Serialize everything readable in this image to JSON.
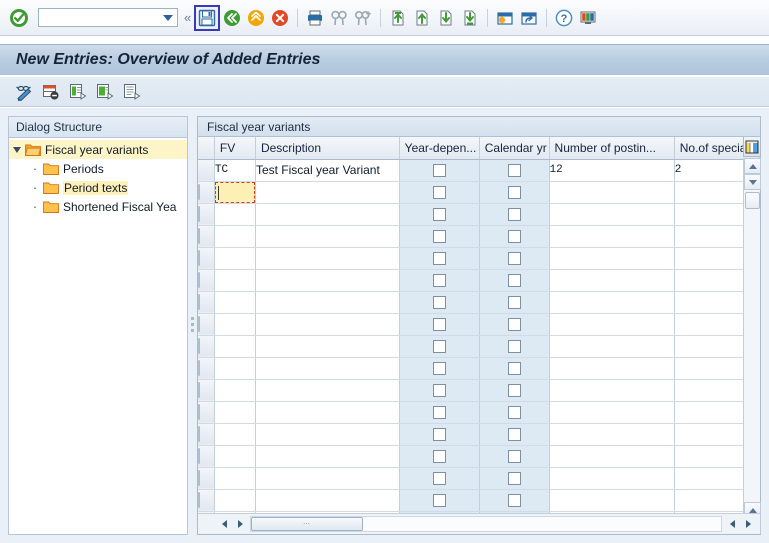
{
  "toolbar": {
    "enter_label": "enter-check",
    "command_value": "",
    "command_placeholder": "",
    "collapse_label": "«",
    "buttons": [
      {
        "name": "save-button",
        "label": "Save",
        "selected": true
      },
      {
        "name": "back-button",
        "label": "Back",
        "selected": false
      },
      {
        "name": "exit-button",
        "label": "Exit",
        "selected": false
      },
      {
        "name": "cancel-button",
        "label": "Cancel",
        "selected": false
      },
      {
        "name": "print-button",
        "label": "Print",
        "selected": false
      },
      {
        "name": "find-button",
        "label": "Find",
        "selected": false
      },
      {
        "name": "find-next-button",
        "label": "Find Next",
        "selected": false
      },
      {
        "name": "first-page-button",
        "label": "First Page",
        "selected": false
      },
      {
        "name": "previous-page-button",
        "label": "Previous Page",
        "selected": false
      },
      {
        "name": "next-page-button",
        "label": "Next Page",
        "selected": false
      },
      {
        "name": "last-page-button",
        "label": "Last Page",
        "selected": false
      },
      {
        "name": "create-session-button",
        "label": "Create New Session",
        "selected": false
      },
      {
        "name": "create-shortcut-button",
        "label": "Create Shortcut",
        "selected": false
      },
      {
        "name": "help-button",
        "label": "Help",
        "selected": false
      },
      {
        "name": "customize-layout-button",
        "label": "Customize Local Layout",
        "selected": false
      }
    ]
  },
  "title": {
    "text": "New Entries: Overview of Added Entries"
  },
  "app_toolbar": {
    "buttons": [
      {
        "name": "new-entries-button",
        "label": "New Entries"
      },
      {
        "name": "delete-entry-button",
        "label": "Delete"
      },
      {
        "name": "copy-as-button",
        "label": "Copy As"
      },
      {
        "name": "undo-change-button",
        "label": "Undo Change"
      },
      {
        "name": "select-all-button",
        "label": "Select Block"
      }
    ]
  },
  "sidebar": {
    "header": "Dialog Structure",
    "items": [
      {
        "label": "Fiscal year variants",
        "level": 0,
        "expanded": true,
        "selected": true,
        "icon": "open-folder-icon"
      },
      {
        "label": "Periods",
        "level": 1,
        "expanded": false,
        "selected": false,
        "icon": "folder-icon"
      },
      {
        "label": "Period texts",
        "level": 1,
        "expanded": false,
        "selected": true,
        "icon": "folder-icon"
      },
      {
        "label": "Shortened Fiscal Yea",
        "level": 1,
        "expanded": false,
        "selected": false,
        "icon": "folder-icon"
      }
    ]
  },
  "table": {
    "title": "Fiscal year variants",
    "columns": [
      {
        "key": "fv",
        "label": "FV",
        "type": "text",
        "width": 40
      },
      {
        "key": "description",
        "label": "Description",
        "type": "text",
        "width": 180
      },
      {
        "key": "year_dependent",
        "label": "Year-depen...",
        "type": "checkbox",
        "width": 78
      },
      {
        "key": "calendar_yr",
        "label": "Calendar yr",
        "type": "checkbox",
        "width": 68
      },
      {
        "key": "number_of_postings",
        "label": "Number of postin...",
        "type": "text",
        "width": 122
      },
      {
        "key": "no_of_special_periods",
        "label": "No.of special peri",
        "type": "text",
        "width": 112
      }
    ],
    "rows": [
      {
        "fv": "TC",
        "description": "Test Fiscal year Variant",
        "year_dependent": false,
        "calendar_yr": false,
        "number_of_postings": "12",
        "no_of_special_periods": "2",
        "editing": false
      },
      {
        "fv": "",
        "description": "",
        "year_dependent": false,
        "calendar_yr": false,
        "number_of_postings": "",
        "no_of_special_periods": "",
        "editing": true
      },
      {
        "fv": "",
        "description": "",
        "year_dependent": false,
        "calendar_yr": false,
        "number_of_postings": "",
        "no_of_special_periods": "",
        "editing": false
      },
      {
        "fv": "",
        "description": "",
        "year_dependent": false,
        "calendar_yr": false,
        "number_of_postings": "",
        "no_of_special_periods": "",
        "editing": false
      },
      {
        "fv": "",
        "description": "",
        "year_dependent": false,
        "calendar_yr": false,
        "number_of_postings": "",
        "no_of_special_periods": "",
        "editing": false
      },
      {
        "fv": "",
        "description": "",
        "year_dependent": false,
        "calendar_yr": false,
        "number_of_postings": "",
        "no_of_special_periods": "",
        "editing": false
      },
      {
        "fv": "",
        "description": "",
        "year_dependent": false,
        "calendar_yr": false,
        "number_of_postings": "",
        "no_of_special_periods": "",
        "editing": false
      },
      {
        "fv": "",
        "description": "",
        "year_dependent": false,
        "calendar_yr": false,
        "number_of_postings": "",
        "no_of_special_periods": "",
        "editing": false
      },
      {
        "fv": "",
        "description": "",
        "year_dependent": false,
        "calendar_yr": false,
        "number_of_postings": "",
        "no_of_special_periods": "",
        "editing": false
      },
      {
        "fv": "",
        "description": "",
        "year_dependent": false,
        "calendar_yr": false,
        "number_of_postings": "",
        "no_of_special_periods": "",
        "editing": false
      },
      {
        "fv": "",
        "description": "",
        "year_dependent": false,
        "calendar_yr": false,
        "number_of_postings": "",
        "no_of_special_periods": "",
        "editing": false
      },
      {
        "fv": "",
        "description": "",
        "year_dependent": false,
        "calendar_yr": false,
        "number_of_postings": "",
        "no_of_special_periods": "",
        "editing": false
      },
      {
        "fv": "",
        "description": "",
        "year_dependent": false,
        "calendar_yr": false,
        "number_of_postings": "",
        "no_of_special_periods": "",
        "editing": false
      },
      {
        "fv": "",
        "description": "",
        "year_dependent": false,
        "calendar_yr": false,
        "number_of_postings": "",
        "no_of_special_periods": "",
        "editing": false
      },
      {
        "fv": "",
        "description": "",
        "year_dependent": false,
        "calendar_yr": false,
        "number_of_postings": "",
        "no_of_special_periods": "",
        "editing": false
      },
      {
        "fv": "",
        "description": "",
        "year_dependent": false,
        "calendar_yr": false,
        "number_of_postings": "",
        "no_of_special_periods": "",
        "editing": false
      },
      {
        "fv": "",
        "description": "",
        "year_dependent": false,
        "calendar_yr": false,
        "number_of_postings": "",
        "no_of_special_periods": "",
        "editing": false
      }
    ],
    "config_button_label": "Table Settings"
  },
  "scrollbars": {
    "vertical_up": "scroll-up",
    "vertical_down": "scroll-down",
    "horizontal_left": "scroll-left",
    "horizontal_right": "scroll-right"
  },
  "colors": {
    "accent_blue": "#3b39b5",
    "title_gradient_top": "#cfdcea",
    "title_gradient_bottom": "#aec4db",
    "selected_row_yellow": "#fdf0b5",
    "edit_frame_red": "#d13b2e",
    "checkbox_cell_blue": "#dde9f3",
    "tree_highlight": "#fdf5c8"
  }
}
